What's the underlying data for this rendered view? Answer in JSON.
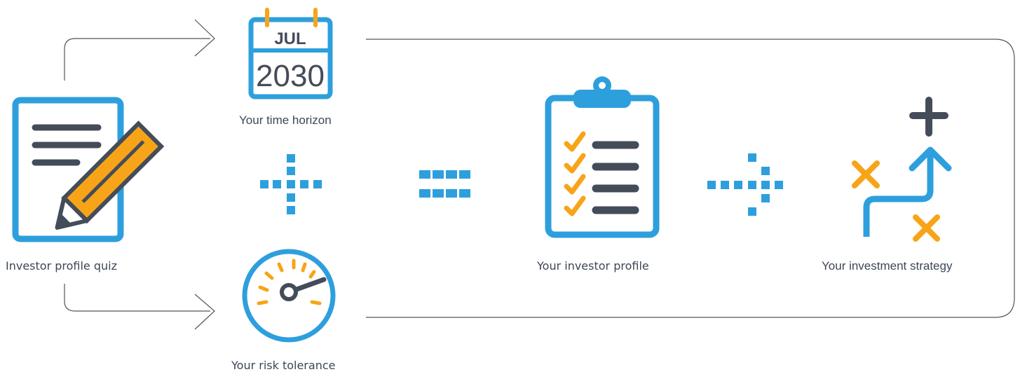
{
  "steps": {
    "quiz": {
      "label": "Investor profile quiz",
      "icon": "document-pencil-icon"
    },
    "time_horizon": {
      "label": "Your time horizon",
      "icon": "calendar-icon",
      "month": "JUL",
      "year": "2030"
    },
    "risk_tolerance": {
      "label": "Your risk tolerance",
      "icon": "speedometer-gauge-icon"
    },
    "investor_profile": {
      "label": "Your investor profile",
      "icon": "clipboard-checklist-icon"
    },
    "investment_strategy": {
      "label": "Your investment strategy",
      "icon": "strategy-path-icon"
    }
  },
  "operators": {
    "plus": "plus-operator-icon",
    "equals": "equals-operator-icon",
    "arrow": "arrow-operator-icon"
  },
  "colors": {
    "blue": "#2e9fdd",
    "orange": "#f7a418",
    "dark": "#444c5a",
    "line": "#555555"
  }
}
